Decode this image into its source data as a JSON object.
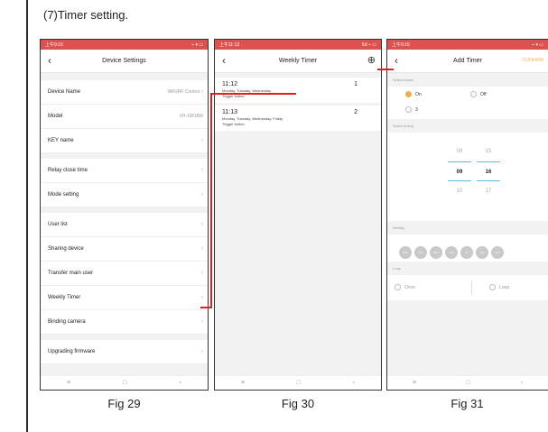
{
  "heading": "(7)Timer setting.",
  "fig29": {
    "caption": "Fig 29",
    "status_left": "上午9:15",
    "status_right": "⌁ ▾ ▭",
    "title": "Device Settings",
    "groups": [
      [
        {
          "label": "Device Name",
          "value": "WiFi/RF Control"
        },
        {
          "label": "Model",
          "value": "XH-SM18W"
        },
        {
          "label": "KEY name",
          "value": ""
        }
      ],
      [
        {
          "label": "Relay close time",
          "value": ""
        },
        {
          "label": "Mode setting",
          "value": ""
        }
      ],
      [
        {
          "label": "User list",
          "value": ""
        },
        {
          "label": "Sharing device",
          "value": ""
        },
        {
          "label": "Transfer main user",
          "value": ""
        },
        {
          "label": "Weekly Timer",
          "value": ""
        },
        {
          "label": "Binding camera",
          "value": ""
        }
      ],
      [
        {
          "label": "Upgrading firmware",
          "value": ""
        }
      ]
    ]
  },
  "fig30": {
    "caption": "Fig 30",
    "status_left": "上午11:13",
    "status_right": "5d ⌁ ▭",
    "title": "Weekly Timer",
    "add_icon": "⊕",
    "timers": [
      {
        "time": "11:12",
        "days": "Monday, Tuesday, Wednesday",
        "action": "Trigger button",
        "index": "1"
      },
      {
        "time": "11:13",
        "days": "Monday, Tuesday, Wednesday, Friday",
        "action": "Trigger button",
        "index": "2"
      }
    ]
  },
  "fig31": {
    "caption": "Fig 31",
    "status_left": "上午9:15",
    "status_right": "⌁ ▾ ▭",
    "title": "Add Timer",
    "confirm": "CONFIRM",
    "select_button_label": "Select button",
    "options": [
      "On",
      "Off",
      "3"
    ],
    "select_timing_label": "Select timing",
    "hours": [
      "08",
      "09",
      "10"
    ],
    "minutes": [
      "15",
      "16",
      "17"
    ],
    "weekly_label": "Weekly",
    "days": [
      "Mon",
      "Tue",
      "Wed",
      "Thu",
      "Fri",
      "Sat",
      "Sun"
    ],
    "loop_label": "Loop",
    "loop_options": [
      "Once",
      "Loop"
    ]
  },
  "colors": {
    "status": "#d9534f",
    "accent": "#f0ad4e",
    "annotation": "#e02020"
  }
}
